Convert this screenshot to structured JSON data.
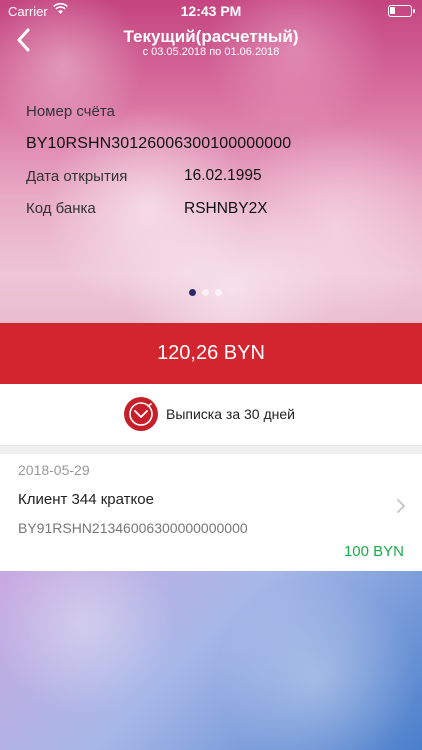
{
  "status_bar": {
    "carrier": "Carrier",
    "time": "12:43 PM",
    "wifi_icon": "wifi-icon",
    "battery_level_percent": 25
  },
  "header": {
    "back_icon": "chevron-left-icon",
    "title": "Текущий(расчетный)",
    "subtitle": "с 03.05.2018 по 01.06.2018"
  },
  "account_card": {
    "number_label": "Номер счёта",
    "number_value": "BY10RSHN30126006300100000000",
    "open_date_label": "Дата открытия",
    "open_date_value": "16.02.1995",
    "bank_code_label": "Код банка",
    "bank_code_value": "RSHNBY2X",
    "page_count": 3,
    "active_page": 1
  },
  "balance": {
    "amount": "120,26 BYN"
  },
  "statement": {
    "label": "Выписка за 30 дней",
    "icon": "statement-clock-icon"
  },
  "transactions": [
    {
      "date": "2018-05-29",
      "name": "Клиент 344 краткое",
      "account": "BY91RSHN21346006300000000000",
      "amount": "100 BYN"
    }
  ],
  "colors": {
    "accent_red": "#d3252f",
    "positive_amount": "#1aab4b",
    "pager_active": "#2c2a66"
  }
}
